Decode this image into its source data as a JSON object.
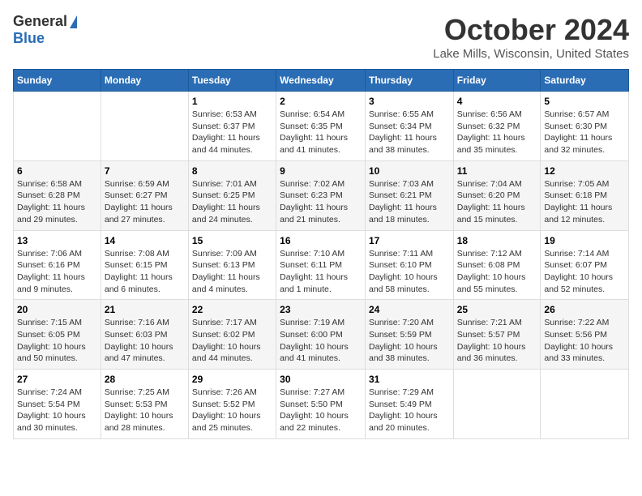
{
  "header": {
    "logo_general": "General",
    "logo_blue": "Blue",
    "title": "October 2024",
    "subtitle": "Lake Mills, Wisconsin, United States"
  },
  "days_of_week": [
    "Sunday",
    "Monday",
    "Tuesday",
    "Wednesday",
    "Thursday",
    "Friday",
    "Saturday"
  ],
  "weeks": [
    [
      {
        "day": "",
        "info": ""
      },
      {
        "day": "",
        "info": ""
      },
      {
        "day": "1",
        "info": "Sunrise: 6:53 AM\nSunset: 6:37 PM\nDaylight: 11 hours and 44 minutes."
      },
      {
        "day": "2",
        "info": "Sunrise: 6:54 AM\nSunset: 6:35 PM\nDaylight: 11 hours and 41 minutes."
      },
      {
        "day": "3",
        "info": "Sunrise: 6:55 AM\nSunset: 6:34 PM\nDaylight: 11 hours and 38 minutes."
      },
      {
        "day": "4",
        "info": "Sunrise: 6:56 AM\nSunset: 6:32 PM\nDaylight: 11 hours and 35 minutes."
      },
      {
        "day": "5",
        "info": "Sunrise: 6:57 AM\nSunset: 6:30 PM\nDaylight: 11 hours and 32 minutes."
      }
    ],
    [
      {
        "day": "6",
        "info": "Sunrise: 6:58 AM\nSunset: 6:28 PM\nDaylight: 11 hours and 29 minutes."
      },
      {
        "day": "7",
        "info": "Sunrise: 6:59 AM\nSunset: 6:27 PM\nDaylight: 11 hours and 27 minutes."
      },
      {
        "day": "8",
        "info": "Sunrise: 7:01 AM\nSunset: 6:25 PM\nDaylight: 11 hours and 24 minutes."
      },
      {
        "day": "9",
        "info": "Sunrise: 7:02 AM\nSunset: 6:23 PM\nDaylight: 11 hours and 21 minutes."
      },
      {
        "day": "10",
        "info": "Sunrise: 7:03 AM\nSunset: 6:21 PM\nDaylight: 11 hours and 18 minutes."
      },
      {
        "day": "11",
        "info": "Sunrise: 7:04 AM\nSunset: 6:20 PM\nDaylight: 11 hours and 15 minutes."
      },
      {
        "day": "12",
        "info": "Sunrise: 7:05 AM\nSunset: 6:18 PM\nDaylight: 11 hours and 12 minutes."
      }
    ],
    [
      {
        "day": "13",
        "info": "Sunrise: 7:06 AM\nSunset: 6:16 PM\nDaylight: 11 hours and 9 minutes."
      },
      {
        "day": "14",
        "info": "Sunrise: 7:08 AM\nSunset: 6:15 PM\nDaylight: 11 hours and 6 minutes."
      },
      {
        "day": "15",
        "info": "Sunrise: 7:09 AM\nSunset: 6:13 PM\nDaylight: 11 hours and 4 minutes."
      },
      {
        "day": "16",
        "info": "Sunrise: 7:10 AM\nSunset: 6:11 PM\nDaylight: 11 hours and 1 minute."
      },
      {
        "day": "17",
        "info": "Sunrise: 7:11 AM\nSunset: 6:10 PM\nDaylight: 10 hours and 58 minutes."
      },
      {
        "day": "18",
        "info": "Sunrise: 7:12 AM\nSunset: 6:08 PM\nDaylight: 10 hours and 55 minutes."
      },
      {
        "day": "19",
        "info": "Sunrise: 7:14 AM\nSunset: 6:07 PM\nDaylight: 10 hours and 52 minutes."
      }
    ],
    [
      {
        "day": "20",
        "info": "Sunrise: 7:15 AM\nSunset: 6:05 PM\nDaylight: 10 hours and 50 minutes."
      },
      {
        "day": "21",
        "info": "Sunrise: 7:16 AM\nSunset: 6:03 PM\nDaylight: 10 hours and 47 minutes."
      },
      {
        "day": "22",
        "info": "Sunrise: 7:17 AM\nSunset: 6:02 PM\nDaylight: 10 hours and 44 minutes."
      },
      {
        "day": "23",
        "info": "Sunrise: 7:19 AM\nSunset: 6:00 PM\nDaylight: 10 hours and 41 minutes."
      },
      {
        "day": "24",
        "info": "Sunrise: 7:20 AM\nSunset: 5:59 PM\nDaylight: 10 hours and 38 minutes."
      },
      {
        "day": "25",
        "info": "Sunrise: 7:21 AM\nSunset: 5:57 PM\nDaylight: 10 hours and 36 minutes."
      },
      {
        "day": "26",
        "info": "Sunrise: 7:22 AM\nSunset: 5:56 PM\nDaylight: 10 hours and 33 minutes."
      }
    ],
    [
      {
        "day": "27",
        "info": "Sunrise: 7:24 AM\nSunset: 5:54 PM\nDaylight: 10 hours and 30 minutes."
      },
      {
        "day": "28",
        "info": "Sunrise: 7:25 AM\nSunset: 5:53 PM\nDaylight: 10 hours and 28 minutes."
      },
      {
        "day": "29",
        "info": "Sunrise: 7:26 AM\nSunset: 5:52 PM\nDaylight: 10 hours and 25 minutes."
      },
      {
        "day": "30",
        "info": "Sunrise: 7:27 AM\nSunset: 5:50 PM\nDaylight: 10 hours and 22 minutes."
      },
      {
        "day": "31",
        "info": "Sunrise: 7:29 AM\nSunset: 5:49 PM\nDaylight: 10 hours and 20 minutes."
      },
      {
        "day": "",
        "info": ""
      },
      {
        "day": "",
        "info": ""
      }
    ]
  ]
}
